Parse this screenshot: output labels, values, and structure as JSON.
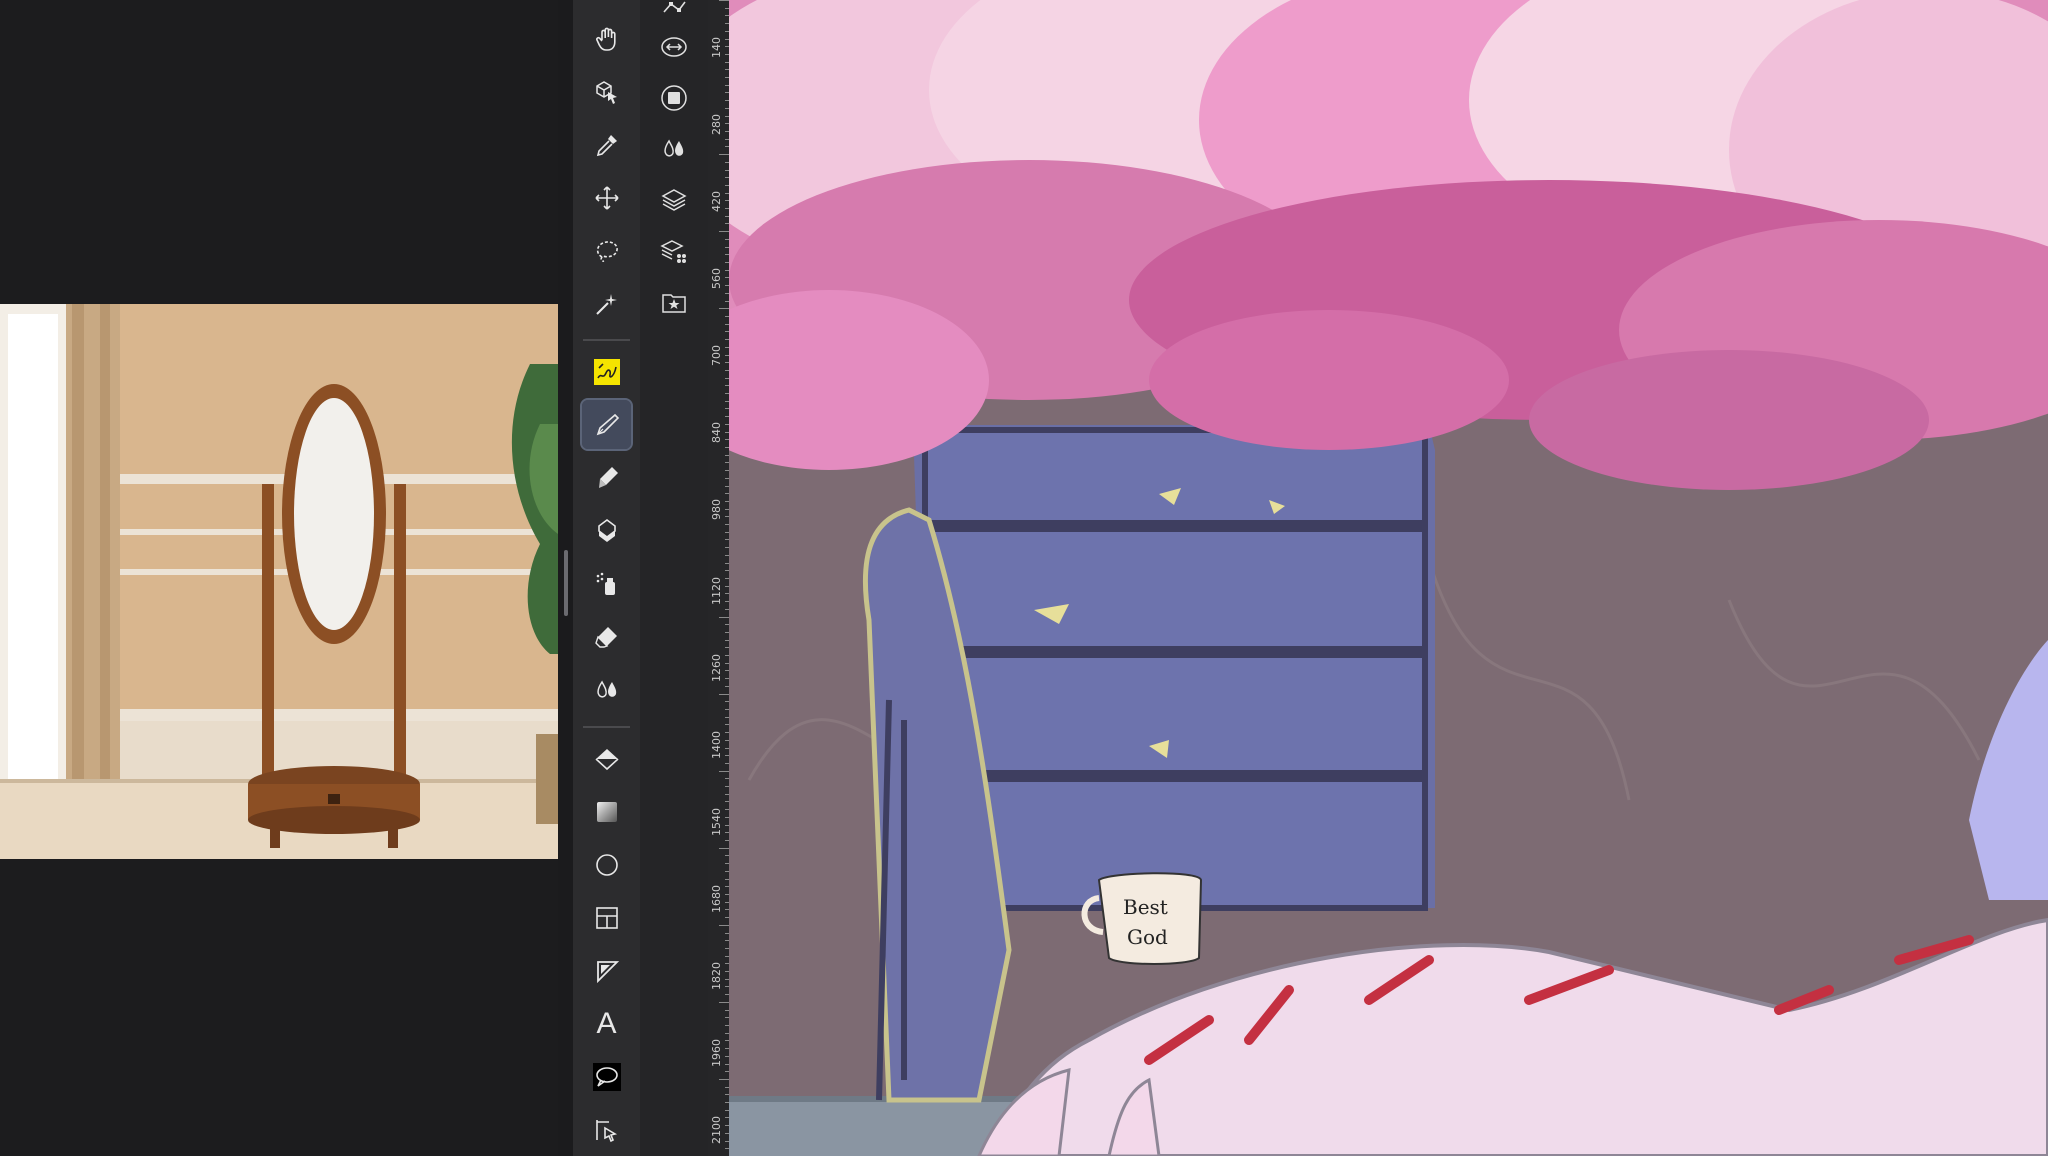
{
  "ruler": {
    "labels": [
      "140",
      "280",
      "420",
      "560",
      "700",
      "840",
      "980",
      "1120",
      "1260",
      "1400",
      "1540",
      "1680",
      "1820",
      "1960",
      "2100"
    ]
  },
  "toolbar": {
    "tools": [
      {
        "name": "hand-tool",
        "icon": "hand-icon"
      },
      {
        "name": "object-select-tool",
        "icon": "cube-cursor-icon"
      },
      {
        "name": "eyedropper-tool",
        "icon": "eyedropper-icon"
      },
      {
        "name": "move-tool",
        "icon": "move-arrows-icon"
      },
      {
        "name": "lasso-tool",
        "icon": "lasso-icon"
      },
      {
        "name": "magic-wand-tool",
        "icon": "magic-wand-icon"
      },
      {
        "name": "brush-plugin-tool",
        "icon": "yellow-badge-icon"
      },
      {
        "name": "pen-tool",
        "icon": "pen-nib-icon",
        "active": true
      },
      {
        "name": "pencil-tool",
        "icon": "pencil-icon"
      },
      {
        "name": "brush-tool",
        "icon": "brush-icon"
      },
      {
        "name": "airbrush-tool",
        "icon": "airbrush-icon"
      },
      {
        "name": "eraser-tool",
        "icon": "eraser-icon"
      },
      {
        "name": "blend-tool",
        "icon": "droplets-icon"
      },
      {
        "name": "fill-tool",
        "icon": "bucket-icon"
      },
      {
        "name": "gradient-tool",
        "icon": "gradient-icon"
      },
      {
        "name": "figure-tool",
        "icon": "circle-icon"
      },
      {
        "name": "frame-border-tool",
        "icon": "frame-icon"
      },
      {
        "name": "ruler-tool",
        "icon": "ruler-triangle-icon"
      },
      {
        "name": "text-tool",
        "icon": "text-icon",
        "glyph": "A"
      },
      {
        "name": "balloon-tool",
        "icon": "speech-balloon-icon"
      },
      {
        "name": "correct-line-tool",
        "icon": "correct-line-icon"
      }
    ]
  },
  "subbar": {
    "items": [
      {
        "name": "subtool-vector",
        "icon": "vector-icon"
      },
      {
        "name": "subtool-transform",
        "icon": "transform-arrows-icon"
      },
      {
        "name": "subtool-mask",
        "icon": "mask-square-icon"
      },
      {
        "name": "subtool-color-mix",
        "icon": "droplets-icon"
      },
      {
        "name": "subtool-layers",
        "icon": "layers-icon"
      },
      {
        "name": "subtool-layer-properties",
        "icon": "layers-settings-icon"
      },
      {
        "name": "subtool-material",
        "icon": "star-folder-icon"
      }
    ]
  },
  "artwork": {
    "mug_text_line1": "Best",
    "mug_text_line2": "God"
  },
  "colors": {
    "accent_active": "#434a5c",
    "toolbar_bg": "#2c2c2e",
    "canvas_wall": "#7d6b73"
  }
}
